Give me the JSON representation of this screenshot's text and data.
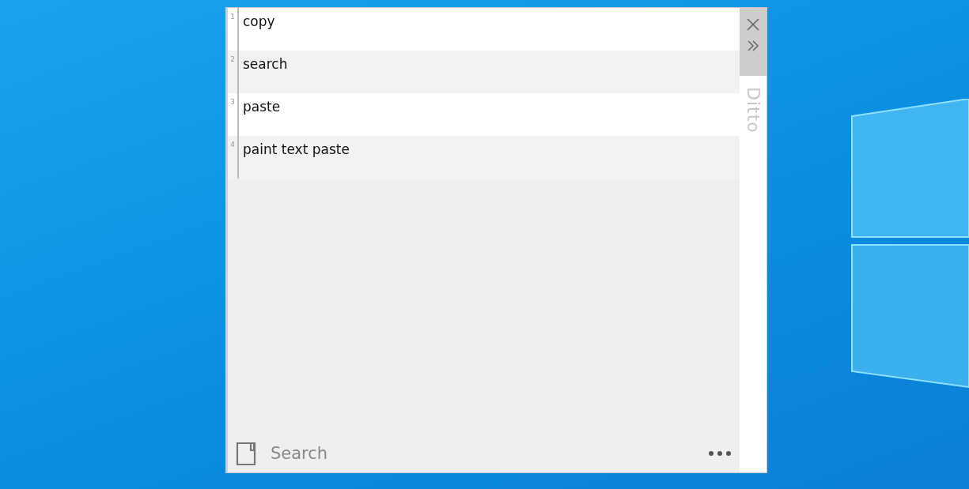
{
  "window": {
    "title": "Ditto"
  },
  "clips": [
    {
      "number": "1",
      "text": "copy"
    },
    {
      "number": "2",
      "text": "search"
    },
    {
      "number": "3",
      "text": "paste"
    },
    {
      "number": "4",
      "text": "paint text paste"
    }
  ],
  "search": {
    "placeholder": "Search"
  }
}
